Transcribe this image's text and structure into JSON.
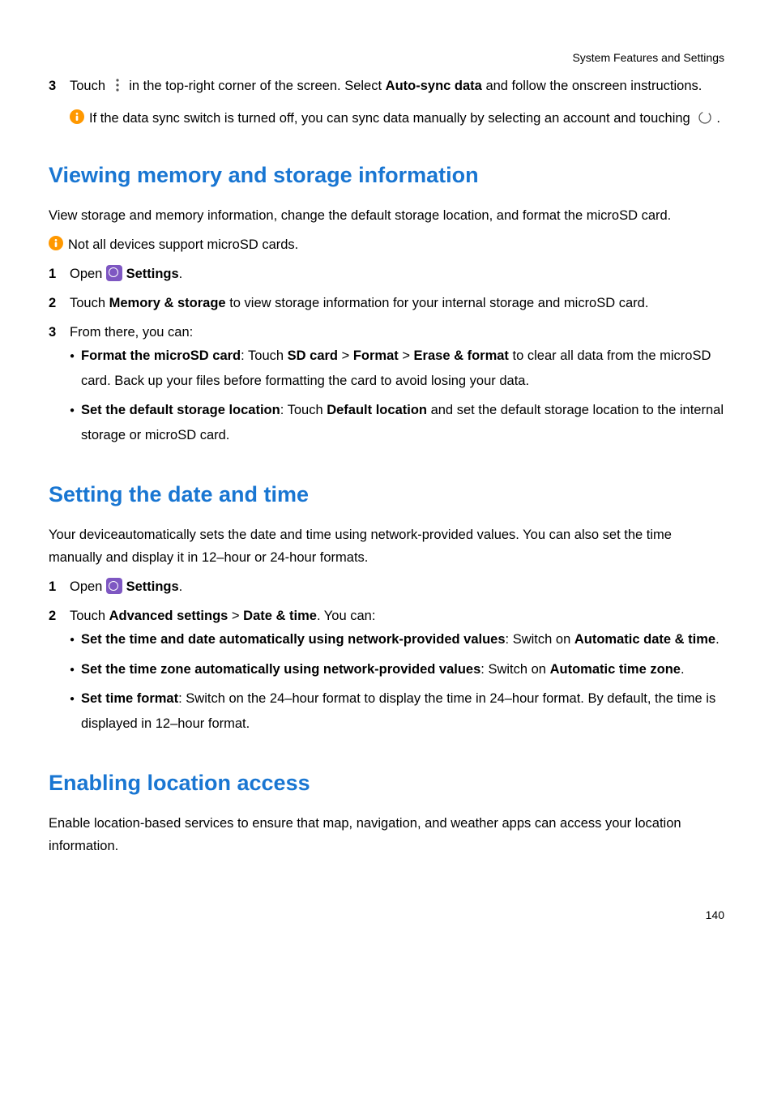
{
  "header": "System Features and Settings",
  "step3_pre": "Touch",
  "step3_post": "in the top-right corner of the screen. Select",
  "step3_bold": "Auto-sync data",
  "step3_end": "and follow the onscreen instructions.",
  "note1_pre": "If the data sync switch is turned off, you can sync data manually by selecting an account and touching",
  "note1_post": ".",
  "h2_1": "Viewing memory and storage information",
  "p1": "View storage and memory information, change the default storage location, and format the microSD card.",
  "note2": "Not all devices support microSD cards.",
  "s1_1_pre": "Open",
  "settings_label": "Settings",
  "s1_2_pre": "Touch",
  "s1_2_b1": "Memory & storage",
  "s1_2_post": "to view storage information for your internal storage and microSD card.",
  "s1_3": "From there, you can:",
  "s1_3_b1_a": "Format the microSD card",
  "s1_3_b1_b": ": Touch",
  "s1_3_b1_c": "SD card",
  "s1_3_b1_d": "Format",
  "s1_3_b1_e": "Erase & format",
  "s1_3_b1_f": "to clear all data from the microSD card. Back up your files before formatting the card to avoid losing your data.",
  "s1_3_b2_a": "Set the default storage location",
  "s1_3_b2_b": ": Touch",
  "s1_3_b2_c": "Default location",
  "s1_3_b2_d": "and set the default storage location to the internal storage or microSD card.",
  "h2_2": "Setting the date and time",
  "p2": "Your deviceautomatically sets the date and time using network-provided values. You can also set the time manually and display it in 12–hour or 24-hour formats.",
  "s2_2_pre": "Touch",
  "s2_2_b1": "Advanced settings",
  "s2_2_b2": "Date & time",
  "s2_2_post": ". You can:",
  "s2_2_bl1_a": "Set the time and date automatically using network-provided values",
  "s2_2_bl1_b": ": Switch on",
  "s2_2_bl1_c": "Automatic date & time",
  "s2_2_bl2_a": "Set the time zone automatically using network-provided values",
  "s2_2_bl2_b": ": Switch on",
  "s2_2_bl2_c": "Automatic time zone",
  "s2_2_bl3_a": "Set time format",
  "s2_2_bl3_b": ": Switch on the 24–hour format to display the time in 24–hour format. By default, the time is displayed in 12–hour format.",
  "h2_3": "Enabling location access",
  "p3": "Enable location-based services to ensure that map, navigation, and weather apps can access your location information.",
  "page_num": "140",
  "nums": {
    "n1": "1",
    "n2": "2",
    "n3": "3"
  }
}
